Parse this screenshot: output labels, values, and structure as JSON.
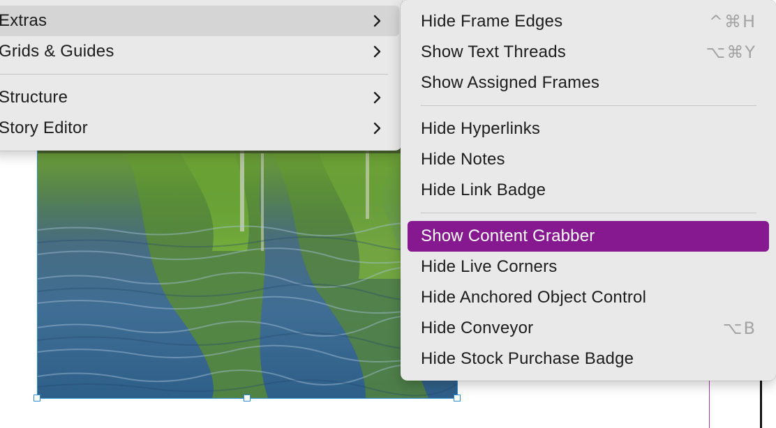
{
  "parent_menu": {
    "items": [
      {
        "label": "Extras",
        "active": true
      },
      {
        "label": "Grids & Guides",
        "active": false
      },
      {
        "label": "Structure",
        "active": false
      },
      {
        "label": "Story Editor",
        "active": false
      }
    ]
  },
  "submenu": {
    "groups": [
      [
        {
          "label": "Hide Frame Edges",
          "shortcut": "^⌘H"
        },
        {
          "label": "Show Text Threads",
          "shortcut": "⌥⌘Y"
        },
        {
          "label": "Show Assigned Frames",
          "shortcut": ""
        }
      ],
      [
        {
          "label": "Hide Hyperlinks",
          "shortcut": ""
        },
        {
          "label": "Hide Notes",
          "shortcut": ""
        },
        {
          "label": "Hide Link Badge",
          "shortcut": ""
        }
      ],
      [
        {
          "label": "Show Content Grabber",
          "shortcut": "",
          "highlighted": true
        },
        {
          "label": "Hide Live Corners",
          "shortcut": ""
        },
        {
          "label": "Hide Anchored Object Control",
          "shortcut": ""
        },
        {
          "label": "Hide Conveyor",
          "shortcut": "⌥B"
        },
        {
          "label": "Hide Stock Purchase Badge",
          "shortcut": ""
        }
      ]
    ]
  },
  "colors": {
    "menu_background": "#e9e9e9",
    "highlight": "#86198f",
    "shortcut_text": "#a3a3a3",
    "frame_selection": "#2f8fd6"
  }
}
